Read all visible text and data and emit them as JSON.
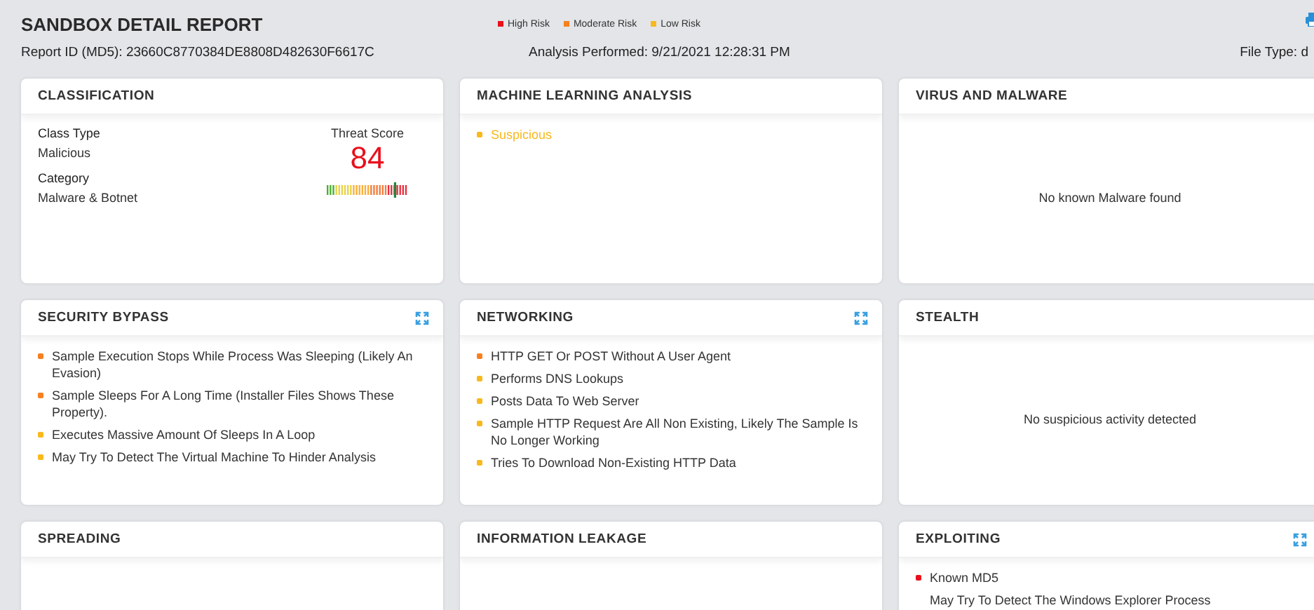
{
  "report": {
    "title": "SANDBOX DETAIL REPORT",
    "report_id": "Report ID (MD5): 23660C8770384DE8808D482630F6617C",
    "analysis": "Analysis Performed: 9/21/2021 12:28:31 PM",
    "file_type": "File Type: d"
  },
  "legend": [
    {
      "label": "High Risk",
      "color": "#e8101c"
    },
    {
      "label": "Moderate Risk",
      "color": "#f7801e"
    },
    {
      "label": "Low Risk",
      "color": "#f9b81b"
    }
  ],
  "cards": [
    {
      "kind": "classification",
      "title": "CLASSIFICATION",
      "expandable": false,
      "class_type_label": "Class Type",
      "class_type": "Malicious",
      "category_label": "Category",
      "category": "Malware & Botnet",
      "score_label": "Threat Score",
      "score": "84",
      "level": 0.84
    },
    {
      "kind": "list",
      "title": "MACHINE LEARNING ANALYSIS",
      "expandable": false,
      "items": [
        {
          "text": "Suspicious",
          "color": "#f9b81b",
          "highlight": true
        }
      ]
    },
    {
      "kind": "message",
      "title": "VIRUS AND MALWARE",
      "expandable": false,
      "message": "No known Malware found"
    },
    {
      "kind": "list",
      "title": "SECURITY BYPASS",
      "expandable": true,
      "items": [
        {
          "text": "Sample Execution Stops While Process Was Sleeping (Likely An Evasion)",
          "color": "#f7801e",
          "highlight": false
        },
        {
          "text": "Sample Sleeps For A Long Time (Installer Files Shows These Property).",
          "color": "#f7801e",
          "highlight": false
        },
        {
          "text": "Executes Massive Amount Of Sleeps In A Loop",
          "color": "#f9b81b",
          "highlight": false
        },
        {
          "text": "May Try To Detect The Virtual Machine To Hinder Analysis",
          "color": "#f9b81b",
          "highlight": false
        }
      ]
    },
    {
      "kind": "list",
      "title": "NETWORKING",
      "expandable": true,
      "items": [
        {
          "text": "HTTP GET Or POST Without A User Agent",
          "color": "#f7801e",
          "highlight": false
        },
        {
          "text": "Performs DNS Lookups",
          "color": "#f9b81b",
          "highlight": false
        },
        {
          "text": "Posts Data To Web Server",
          "color": "#f9b81b",
          "highlight": false
        },
        {
          "text": "Sample HTTP Request Are All Non Existing, Likely The Sample Is No Longer Working",
          "color": "#f9b81b",
          "highlight": false
        },
        {
          "text": "Tries To Download Non-Existing HTTP Data",
          "color": "#f9b81b",
          "highlight": false
        }
      ]
    },
    {
      "kind": "message",
      "title": "STEALTH",
      "expandable": false,
      "message": "No suspicious activity detected"
    },
    {
      "kind": "list",
      "title": "SPREADING",
      "expandable": false
    },
    {
      "kind": "list",
      "title": "INFORMATION LEAKAGE",
      "expandable": false
    },
    {
      "kind": "list",
      "title": "EXPLOITING",
      "expandable": true,
      "items": [
        {
          "text": "Known MD5",
          "color": "#e8101c",
          "highlight": false
        },
        {
          "text": "May Try To Detect The Windows Explorer Process",
          "highlight": false
        }
      ]
    }
  ]
}
